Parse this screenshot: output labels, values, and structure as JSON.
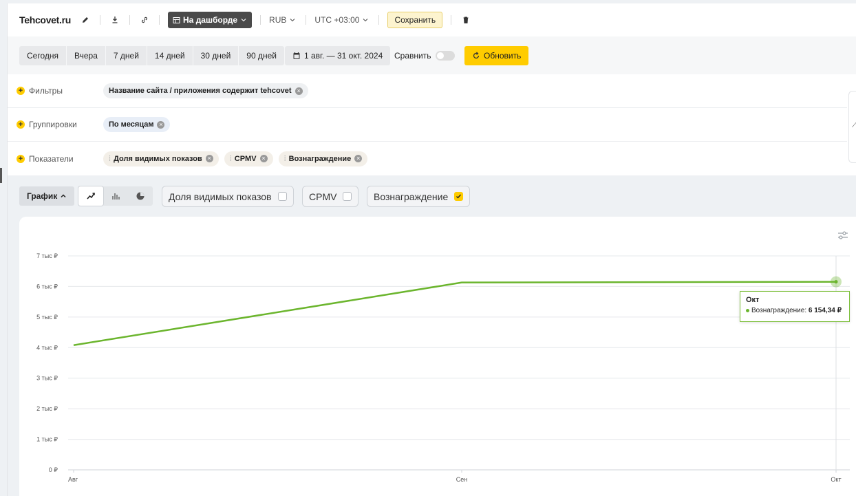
{
  "toolbar": {
    "site_name": "Tehcovet.ru",
    "dashboard_label": "На дашборде",
    "currency": "RUB",
    "timezone": "UTC +03:00",
    "save_label": "Сохранить"
  },
  "period": {
    "presets": [
      "Сегодня",
      "Вчера",
      "7 дней",
      "14 дней",
      "30 дней",
      "90 дней"
    ],
    "date_range": "1 авг. — 31 окт. 2024",
    "compare_label": "Сравнить",
    "compare_on": false,
    "refresh_label": "Обновить"
  },
  "filters": {
    "filters_label": "Фильтры",
    "filter_chip": "Название сайта / приложения содержит tehcovet",
    "groupings_label": "Группировки",
    "grouping_chip": "По месяцам",
    "metrics_label": "Показатели",
    "metric_chips": [
      "Доля видимых показов",
      "CPMV",
      "Вознаграждение"
    ]
  },
  "controls": {
    "graph_label": "График",
    "metrics": [
      {
        "label": "Доля видимых показов",
        "checked": false
      },
      {
        "label": "CPMV",
        "checked": false
      },
      {
        "label": "Вознаграждение",
        "checked": true
      }
    ]
  },
  "chart_data": {
    "type": "line",
    "categories": [
      "Авг",
      "Сен",
      "Окт"
    ],
    "series": [
      {
        "values": [
          4080,
          6130,
          6154.34
        ],
        "color": "#6bb52d"
      }
    ],
    "y_ticks": [
      "0 ₽",
      "1 тыс ₽",
      "2 тыс ₽",
      "3 тыс ₽",
      "4 тыс ₽",
      "5 тыс ₽",
      "6 тыс ₽",
      "7 тыс ₽"
    ],
    "ylim": [
      0,
      7000
    ],
    "grid": true,
    "tooltip": {
      "title": "Окт",
      "label": "Вознаграждение:",
      "value": "6 154,34 ₽"
    }
  }
}
